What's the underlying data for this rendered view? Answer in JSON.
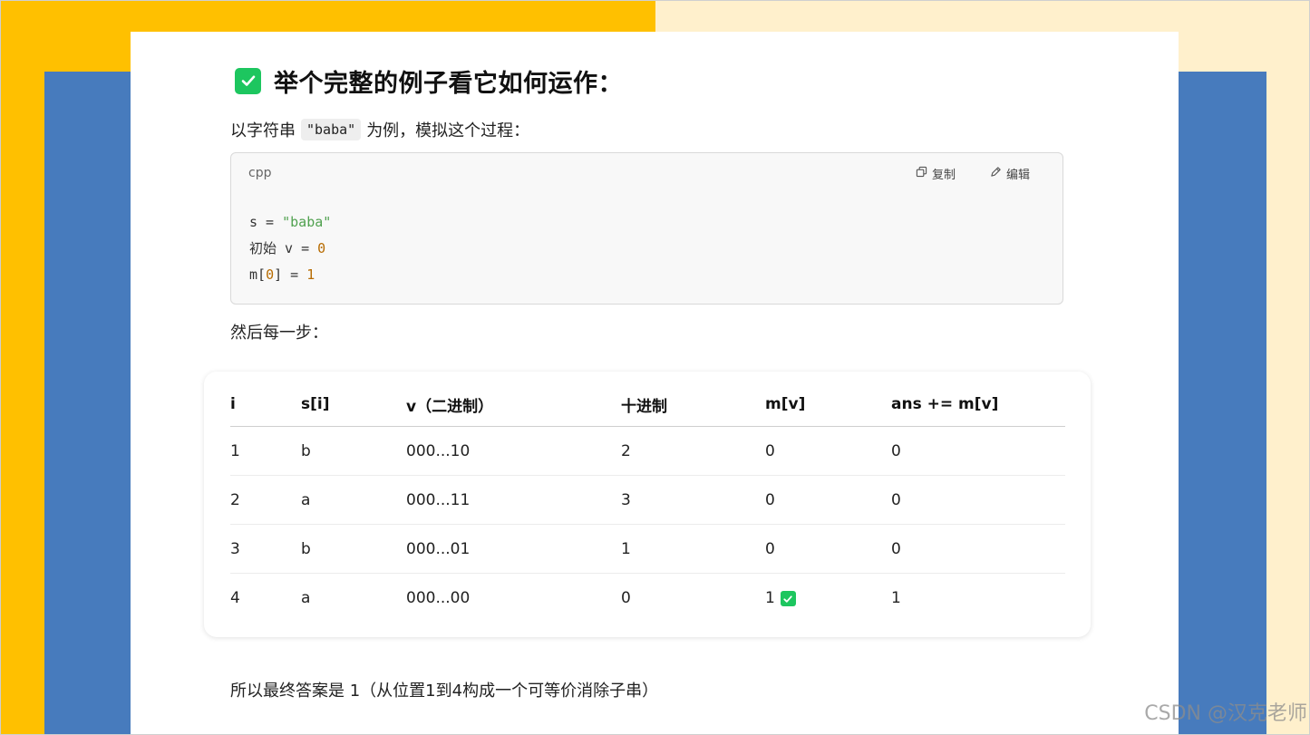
{
  "heading": {
    "title": "举个完整的例子看它如何运作："
  },
  "intro": {
    "before": "以字符串",
    "code": "\"baba\"",
    "after": "为例，模拟这个过程："
  },
  "codeblock": {
    "language": "cpp",
    "copy_label": "复制",
    "edit_label": "编辑",
    "lines": [
      [
        {
          "t": "s = ",
          "c": "plain"
        },
        {
          "t": "\"baba\"",
          "c": "str"
        }
      ],
      [
        {
          "t": "初始 v = ",
          "c": "plain"
        },
        {
          "t": "0",
          "c": "num"
        }
      ],
      [
        {
          "t": "m[",
          "c": "plain"
        },
        {
          "t": "0",
          "c": "num"
        },
        {
          "t": "] = ",
          "c": "plain"
        },
        {
          "t": "1",
          "c": "num"
        }
      ]
    ]
  },
  "then_text": "然后每一步：",
  "table": {
    "headers": [
      "i",
      "s[i]",
      "v（二进制）",
      "十进制",
      "m[v]",
      "ans += m[v]"
    ],
    "rows": [
      {
        "i": "1",
        "s": "b",
        "v": "000...10",
        "d": "2",
        "m": "0",
        "ans": "0",
        "check": false
      },
      {
        "i": "2",
        "s": "a",
        "v": "000...11",
        "d": "3",
        "m": "0",
        "ans": "0",
        "check": false
      },
      {
        "i": "3",
        "s": "b",
        "v": "000...01",
        "d": "1",
        "m": "0",
        "ans": "0",
        "check": false
      },
      {
        "i": "4",
        "s": "a",
        "v": "000...00",
        "d": "0",
        "m": "1",
        "ans": "1",
        "check": true
      }
    ]
  },
  "conclusion": "所以最终答案是 1（从位置1到4构成一个可等价消除子串）",
  "watermark": "CSDN @汉克老师",
  "colors": {
    "accent_green": "#1DC65F",
    "yellow": "#FFC000",
    "blue": "#477BBD",
    "cream": "#FFF0CC"
  }
}
